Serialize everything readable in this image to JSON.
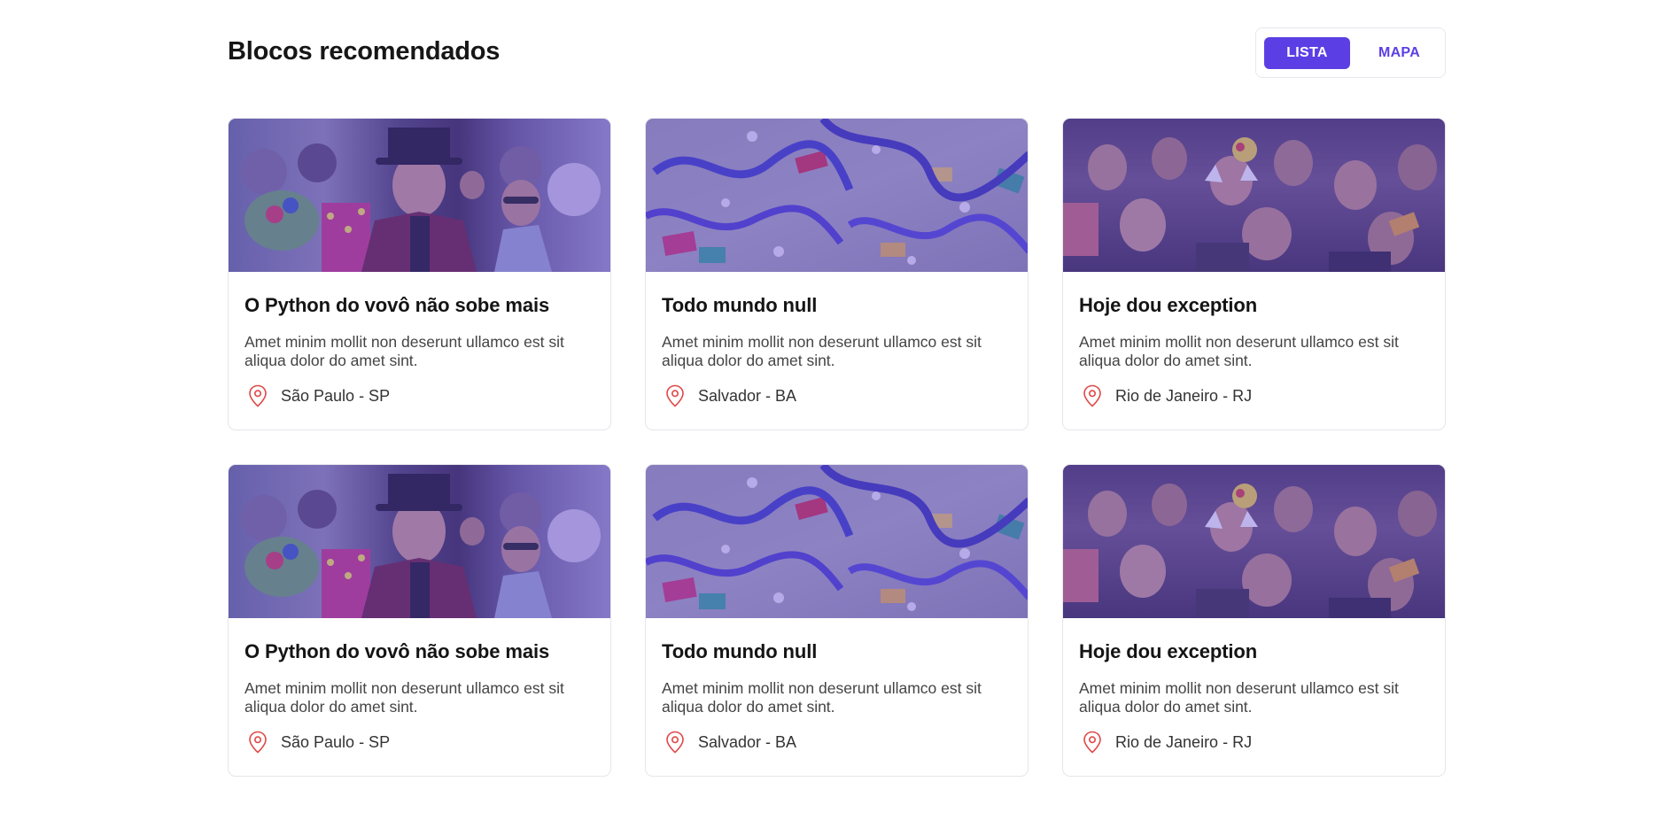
{
  "header": {
    "title": "Blocos recomendados",
    "view_toggle": {
      "list_label": "LISTA",
      "map_label": "MAPA",
      "selected": "LISTA"
    }
  },
  "colors": {
    "accent": "#5b3fe4",
    "pin": "#e04848",
    "image_overlay": "#5f46e6"
  },
  "cards": [
    {
      "title": "O Python do vovô não sobe mais",
      "description": "Amet minim mollit non deserunt ullamco est sit aliqua dolor do amet sint.",
      "location": "São Paulo - SP",
      "image": "carnival-crowd-top-hat"
    },
    {
      "title": "Todo mundo null",
      "description": "Amet minim mollit non deserunt ullamco est sit aliqua dolor do amet sint.",
      "location": "Salvador - BA",
      "image": "confetti-streamers"
    },
    {
      "title": "Hoje dou exception",
      "description": "Amet minim mollit non deserunt ullamco est sit aliqua dolor do amet sint.",
      "location": "Rio de Janeiro - RJ",
      "image": "party-crowd"
    },
    {
      "title": "O Python do vovô não sobe mais",
      "description": "Amet minim mollit non deserunt ullamco est sit aliqua dolor do amet sint.",
      "location": "São Paulo - SP",
      "image": "carnival-crowd-top-hat"
    },
    {
      "title": "Todo mundo null",
      "description": "Amet minim mollit non deserunt ullamco est sit aliqua dolor do amet sint.",
      "location": "Salvador - BA",
      "image": "confetti-streamers"
    },
    {
      "title": "Hoje dou exception",
      "description": "Amet minim mollit non deserunt ullamco est sit aliqua dolor do amet sint.",
      "location": "Rio de Janeiro - RJ",
      "image": "party-crowd"
    }
  ]
}
